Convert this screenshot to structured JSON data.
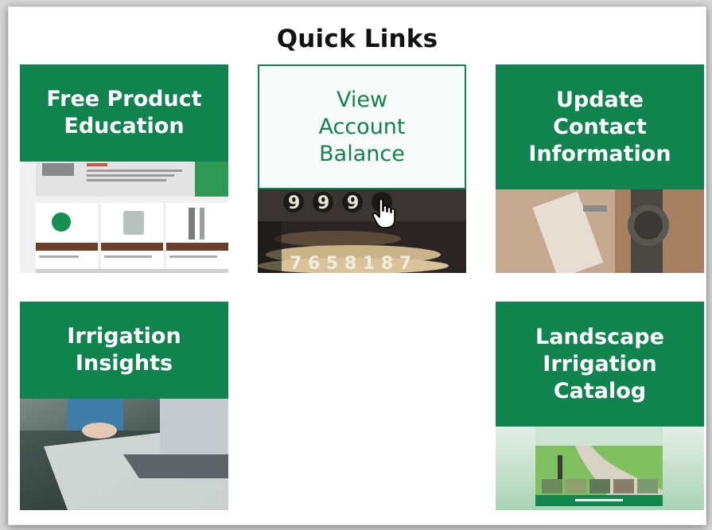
{
  "page": {
    "title": "Quick Links"
  },
  "brand": {
    "green": "#10834f",
    "white": "#ffffff"
  },
  "tiles": [
    {
      "lines": [
        "Free Product",
        "Education"
      ],
      "icon": "brochure-image"
    },
    {
      "lines": [
        "View",
        "Account",
        "Balance"
      ],
      "icon": "odometer-image"
    },
    {
      "lines": [
        "Update",
        "Contact",
        "Information"
      ],
      "icon": "wristwatch-image"
    },
    {
      "lines": [
        "Irrigation",
        "Insights"
      ],
      "icon": "laptop-image"
    },
    {
      "lines": [
        "Landscape",
        "Irrigation",
        "Catalog"
      ],
      "icon": "catalog-image"
    }
  ],
  "cursor": {
    "icon": "hand-pointer-icon"
  }
}
